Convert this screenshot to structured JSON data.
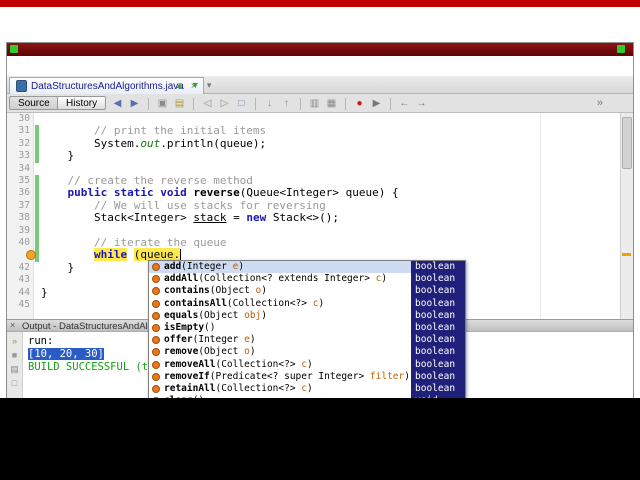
{
  "window": {
    "tab": {
      "label": "DataStructuresAndAlgorithms.java",
      "close_glyph": "×"
    },
    "tab_extra_icons": [
      {
        "name": "previous-document-icon",
        "glyph": "▲",
        "color": "#3f9f3f"
      },
      {
        "name": "next-document-icon",
        "glyph": "▼",
        "color": "#3f9f3f"
      },
      {
        "name": "document-list-icon",
        "glyph": "▾",
        "color": "#777777"
      }
    ],
    "toolbar": {
      "source": "Source",
      "history": "History",
      "icons": [
        {
          "name": "back-icon",
          "glyph": "◀",
          "color": "#5a6fb0"
        },
        {
          "name": "forward-icon",
          "glyph": "▶",
          "color": "#5a6fb0"
        },
        {
          "name": "sep"
        },
        {
          "name": "find-selection-icon",
          "glyph": "▣",
          "color": "#8a8a8a"
        },
        {
          "name": "highlight-icon",
          "glyph": "▤",
          "color": "#b09a30"
        },
        {
          "name": "sep"
        },
        {
          "name": "previous-bookmark-icon",
          "glyph": "◁",
          "color": "#888888"
        },
        {
          "name": "next-bookmark-icon",
          "glyph": "▷",
          "color": "#888888"
        },
        {
          "name": "toggle-bookmark-icon",
          "glyph": "□",
          "color": "#6a8ab0"
        },
        {
          "name": "sep"
        },
        {
          "name": "next-error-icon",
          "glyph": "↓",
          "color": "#888888"
        },
        {
          "name": "previous-error-icon",
          "glyph": "↑",
          "color": "#888888"
        },
        {
          "name": "sep"
        },
        {
          "name": "comment-icon",
          "glyph": "▥",
          "color": "#888888"
        },
        {
          "name": "uncomment-icon",
          "glyph": "▦",
          "color": "#888888"
        },
        {
          "name": "sep"
        },
        {
          "name": "record-macro-icon",
          "glyph": "●",
          "color": "#cc1515"
        },
        {
          "name": "run-macro-icon",
          "glyph": "▶",
          "color": "#777777"
        },
        {
          "name": "sep"
        },
        {
          "name": "shift-left-icon",
          "glyph": "←",
          "color": "#777777"
        },
        {
          "name": "shift-right-icon",
          "glyph": "→",
          "color": "#777777"
        }
      ],
      "right_icon": {
        "name": "toolbar-overflow-icon",
        "glyph": "»"
      }
    }
  },
  "editor": {
    "lines": [
      {
        "no": 30,
        "changed": false,
        "tokens": []
      },
      {
        "no": 31,
        "changed": true,
        "tokens": [
          {
            "t": "        ",
            "s": "pl"
          },
          {
            "t": "// print the initial items",
            "s": "cm"
          }
        ]
      },
      {
        "no": 32,
        "changed": true,
        "tokens": [
          {
            "t": "        System.",
            "s": "pl"
          },
          {
            "t": "out",
            "s": "fld"
          },
          {
            "t": ".println(queue);",
            "s": "pl"
          }
        ]
      },
      {
        "no": 33,
        "changed": true,
        "tokens": [
          {
            "t": "    }",
            "s": "pl"
          }
        ]
      },
      {
        "no": 34,
        "changed": false,
        "tokens": []
      },
      {
        "no": 35,
        "changed": true,
        "tokens": [
          {
            "t": "    ",
            "s": "pl"
          },
          {
            "t": "// create the reverse method",
            "s": "cm"
          }
        ]
      },
      {
        "no": 36,
        "changed": true,
        "tokens": [
          {
            "t": "    ",
            "s": "pl"
          },
          {
            "t": "public static void",
            "s": "kw"
          },
          {
            "t": " ",
            "s": "pl"
          },
          {
            "t": "reverse",
            "s": "md"
          },
          {
            "t": "(Queue<Integer> queue) {",
            "s": "pl"
          }
        ]
      },
      {
        "no": 37,
        "changed": true,
        "tokens": [
          {
            "t": "        ",
            "s": "pl"
          },
          {
            "t": "// We will use stacks for reversing",
            "s": "cm"
          }
        ]
      },
      {
        "no": 38,
        "changed": true,
        "tokens": [
          {
            "t": "        Stack<Integer> ",
            "s": "pl"
          },
          {
            "t": "stack",
            "s": "un"
          },
          {
            "t": " = ",
            "s": "pl"
          },
          {
            "t": "new",
            "s": "kw"
          },
          {
            "t": " Stack<>();",
            "s": "pl"
          }
        ]
      },
      {
        "no": 39,
        "changed": true,
        "tokens": []
      },
      {
        "no": 40,
        "changed": true,
        "tokens": [
          {
            "t": "        ",
            "s": "pl"
          },
          {
            "t": "// iterate the queue",
            "s": "cm"
          }
        ]
      },
      {
        "no": 41,
        "changed": true,
        "annotation": "error",
        "tokens": [
          {
            "t": "        ",
            "s": "pl"
          },
          {
            "t": "while",
            "s": "kwhl"
          },
          {
            "t": " ",
            "s": "pl"
          },
          {
            "t": "(queue.",
            "s": "hl"
          },
          {
            "t": "",
            "s": "caret"
          }
        ]
      },
      {
        "no": 42,
        "changed": false,
        "tokens": [
          {
            "t": "    }",
            "s": "pl"
          }
        ]
      },
      {
        "no": 43,
        "changed": false,
        "tokens": []
      },
      {
        "no": 44,
        "changed": false,
        "tokens": [
          {
            "t": "}",
            "s": "pl"
          }
        ]
      },
      {
        "no": 45,
        "changed": false,
        "tokens": []
      }
    ]
  },
  "completion": {
    "rows": [
      {
        "selected": true,
        "ret": "boolean",
        "tokens": [
          {
            "t": "add",
            "s": "m"
          },
          {
            "t": "(Integer ",
            "s": "p"
          },
          {
            "t": "e",
            "s": "o"
          },
          {
            "t": ")",
            "s": "p"
          }
        ]
      },
      {
        "ret": "boolean",
        "tokens": [
          {
            "t": "addAll",
            "s": "m"
          },
          {
            "t": "(Collection<? extends Integer> ",
            "s": "p"
          },
          {
            "t": "c",
            "s": "o"
          },
          {
            "t": ")",
            "s": "p"
          }
        ]
      },
      {
        "ret": "boolean",
        "tokens": [
          {
            "t": "contains",
            "s": "m"
          },
          {
            "t": "(Object ",
            "s": "p"
          },
          {
            "t": "o",
            "s": "o"
          },
          {
            "t": ")",
            "s": "p"
          }
        ]
      },
      {
        "ret": "boolean",
        "tokens": [
          {
            "t": "containsAll",
            "s": "m"
          },
          {
            "t": "(Collection<?> ",
            "s": "p"
          },
          {
            "t": "c",
            "s": "o"
          },
          {
            "t": ")",
            "s": "p"
          }
        ]
      },
      {
        "ret": "boolean",
        "tokens": [
          {
            "t": "equals",
            "s": "m"
          },
          {
            "t": "(Object ",
            "s": "p"
          },
          {
            "t": "obj",
            "s": "o"
          },
          {
            "t": ")",
            "s": "p"
          }
        ]
      },
      {
        "ret": "boolean",
        "tokens": [
          {
            "t": "isEmpty",
            "s": "m"
          },
          {
            "t": "()",
            "s": "p"
          }
        ]
      },
      {
        "ret": "boolean",
        "tokens": [
          {
            "t": "offer",
            "s": "m"
          },
          {
            "t": "(Integer ",
            "s": "p"
          },
          {
            "t": "e",
            "s": "o"
          },
          {
            "t": ")",
            "s": "p"
          }
        ]
      },
      {
        "ret": "boolean",
        "tokens": [
          {
            "t": "remove",
            "s": "m"
          },
          {
            "t": "(Object ",
            "s": "p"
          },
          {
            "t": "o",
            "s": "o"
          },
          {
            "t": ")",
            "s": "p"
          }
        ]
      },
      {
        "ret": "boolean",
        "tokens": [
          {
            "t": "removeAll",
            "s": "m"
          },
          {
            "t": "(Collection<?> ",
            "s": "p"
          },
          {
            "t": "c",
            "s": "o"
          },
          {
            "t": ")",
            "s": "p"
          }
        ]
      },
      {
        "ret": "boolean",
        "tokens": [
          {
            "t": "removeIf",
            "s": "m"
          },
          {
            "t": "(Predicate<? super Integer> ",
            "s": "p"
          },
          {
            "t": "filter",
            "s": "o"
          },
          {
            "t": ")",
            "s": "p"
          }
        ]
      },
      {
        "ret": "boolean",
        "tokens": [
          {
            "t": "retainAll",
            "s": "m"
          },
          {
            "t": "(Collection<?> ",
            "s": "p"
          },
          {
            "t": "c",
            "s": "o"
          },
          {
            "t": ")",
            "s": "p"
          }
        ]
      },
      {
        "ret": "void",
        "tokens": [
          {
            "t": "clear",
            "s": "m"
          },
          {
            "t": "()",
            "s": "p"
          }
        ]
      }
    ]
  },
  "output": {
    "header": {
      "label": "Output - DataStructuresAndAlgorith",
      "close_glyph": "×"
    },
    "side_icons": [
      {
        "name": "rerun-icon",
        "glyph": "»",
        "color": "#a8a018"
      },
      {
        "name": "stop-icon",
        "glyph": "■",
        "color": "#9a9a9a"
      },
      {
        "name": "output-settings-icon",
        "glyph": "▤",
        "color": "#888888"
      },
      {
        "name": "clear-output-icon",
        "glyph": "□",
        "color": "#888888"
      }
    ],
    "lines": [
      {
        "text": "run:",
        "style": "plain"
      },
      {
        "text": "[10, 20, 30]",
        "style": "selected"
      },
      {
        "text": "BUILD SUCCESSFUL (to",
        "style": "success"
      }
    ]
  }
}
